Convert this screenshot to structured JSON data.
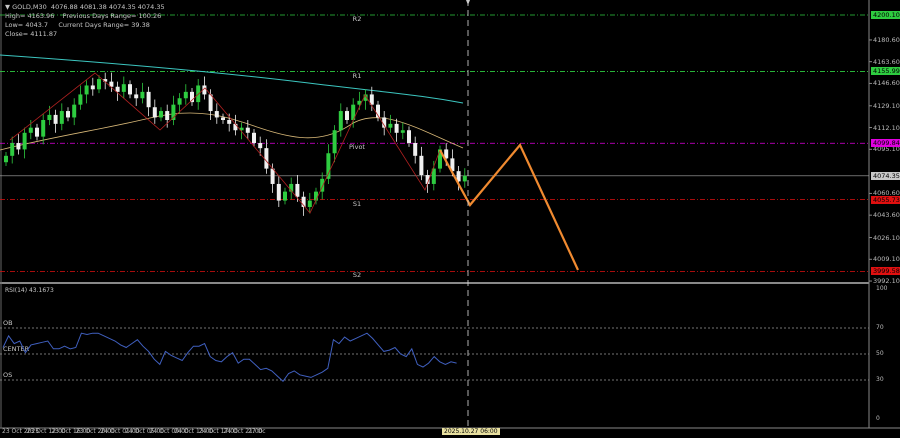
{
  "header": {
    "symbol_line": "GOLD,M30  4076.88 4081.38 4074.35 4074.35",
    "high_line": "High= 4163.96    Previous Days Range= 100.26",
    "low_line": "Low= 4043.7     Current Days Range= 39.38",
    "close_line": "Close= 4111.87"
  },
  "pivots": [
    {
      "label": "R2",
      "value": "4200.10",
      "color": "#2ecc40"
    },
    {
      "label": "R1",
      "value": "4155.99",
      "color": "#2ecc40"
    },
    {
      "label": "Pivot",
      "value": "4099.84",
      "color": "#e000e0"
    },
    {
      "label": "S1",
      "value": "4055.73",
      "color": "#e01010"
    },
    {
      "label": "S2",
      "value": "3999.58",
      "color": "#e01010"
    }
  ],
  "current_price": "4074.35",
  "price_ticks": [
    "4180.60",
    "4163.60",
    "4146.60",
    "4129.10",
    "4112.10",
    "4095.10",
    "4060.60",
    "4043.60",
    "4026.10",
    "4009.10",
    "3992.10"
  ],
  "closes": [
    4090,
    4100,
    4095,
    4108,
    4112,
    4105,
    4118,
    4122,
    4115,
    4125,
    4120,
    4130,
    4138,
    4145,
    4142,
    4150,
    4148,
    4144,
    4140,
    4146,
    4138,
    4135,
    4140,
    4128,
    4120,
    4125,
    4118,
    4130,
    4135,
    4140,
    4132,
    4145,
    4138,
    4125,
    4120,
    4118,
    4115,
    4110,
    4112,
    4108,
    4100,
    4096,
    4080,
    4068,
    4055,
    4062,
    4068,
    4058,
    4050,
    4055,
    4062,
    4072,
    4092,
    4110,
    4125,
    4118,
    4130,
    4133,
    4138,
    4130,
    4120,
    4112,
    4115,
    4108,
    4110,
    4100,
    4090,
    4075,
    4068,
    4080,
    4095,
    4088,
    4078,
    4070,
    4074.35
  ],
  "rsi": {
    "label": "RSI(14) 43.1673",
    "levels": [
      "OB",
      "CENTER",
      "OS"
    ],
    "ticks": [
      "100",
      "70",
      "50",
      "30",
      "0"
    ],
    "values": [
      55,
      64,
      58,
      60,
      51,
      57,
      58,
      59,
      60,
      54,
      54,
      56,
      54,
      55,
      66,
      65,
      66,
      66,
      64,
      62,
      60,
      57,
      55,
      58,
      61,
      56,
      52,
      46,
      42,
      52,
      49,
      47,
      45,
      51,
      56,
      56,
      58,
      48,
      45,
      44,
      48,
      51,
      43,
      46,
      46,
      42,
      38,
      39,
      37,
      33,
      29,
      35,
      37,
      34,
      33,
      32,
      34,
      36,
      39,
      61,
      58,
      63,
      60,
      62,
      64,
      66,
      62,
      57,
      52,
      53,
      55,
      50,
      48,
      54,
      42,
      40,
      43,
      48,
      44,
      42,
      44,
      43
    ]
  },
  "time_labels": [
    "23 Oct 2025",
    "23 Oct 12:00",
    "23 Oct 16:00",
    "23 Oct 20:00",
    "24 Oct 01:00",
    "24 Oct 05:00",
    "24 Oct 09:00",
    "24 Oct 13:00",
    "24 Oct 17:00",
    "24 Oct 21:00",
    "27 Oc"
  ],
  "crosshair_time": "2025.10.27 06:00",
  "colors": {
    "bull": "#2ecc40",
    "bear": "#f0f0f0",
    "ma_slow": "#3cc6c0",
    "ma_fast": "#d8b878",
    "zigzag": "#b02020",
    "projection": "#f08a30",
    "rsi": "#4060c0"
  }
}
